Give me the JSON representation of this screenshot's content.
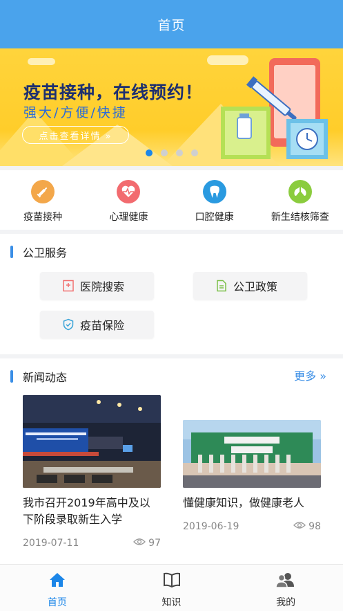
{
  "header": {
    "title": "首页"
  },
  "banner": {
    "title": "疫苗接种，在线预约！",
    "subtitle": "强大/方便/快捷",
    "button": "点击查看详情 »",
    "dots": 4,
    "active_dot": 0
  },
  "quick_links": [
    {
      "label": "疫苗接种",
      "icon": "syringe-icon",
      "color": "#f3a74a"
    },
    {
      "label": "心理健康",
      "icon": "heartbeat-icon",
      "color": "#f26b6f"
    },
    {
      "label": "口腔健康",
      "icon": "tooth-icon",
      "color": "#2a9ae0"
    },
    {
      "label": "新生结核筛查",
      "icon": "lungs-icon",
      "color": "#8bcc3e"
    }
  ],
  "public_health": {
    "title": "公卫服务",
    "services": [
      {
        "label": "医院搜索",
        "icon": "hospital-icon",
        "color": "#f17070"
      },
      {
        "label": "公卫政策",
        "icon": "document-icon",
        "color": "#7cc04a"
      },
      {
        "label": "疫苗保险",
        "icon": "shield-icon",
        "color": "#3aa4d8"
      }
    ]
  },
  "news": {
    "title": "新闻动态",
    "more": "更多 »",
    "items": [
      {
        "title": "我市召开2019年高中及以下阶段录取新生入学",
        "date": "2019-07-11",
        "views": "97"
      },
      {
        "title": "懂健康知识，做健康老人",
        "date": "2019-06-19",
        "views": "98"
      }
    ]
  },
  "tabbar": [
    {
      "label": "首页",
      "icon": "home-icon",
      "active": true
    },
    {
      "label": "知识",
      "icon": "book-icon",
      "active": false
    },
    {
      "label": "我的",
      "icon": "users-icon",
      "active": false
    }
  ],
  "colors": {
    "primary": "#4aa3ec",
    "accent": "#1c86e8",
    "banner": "#ffd43c"
  }
}
